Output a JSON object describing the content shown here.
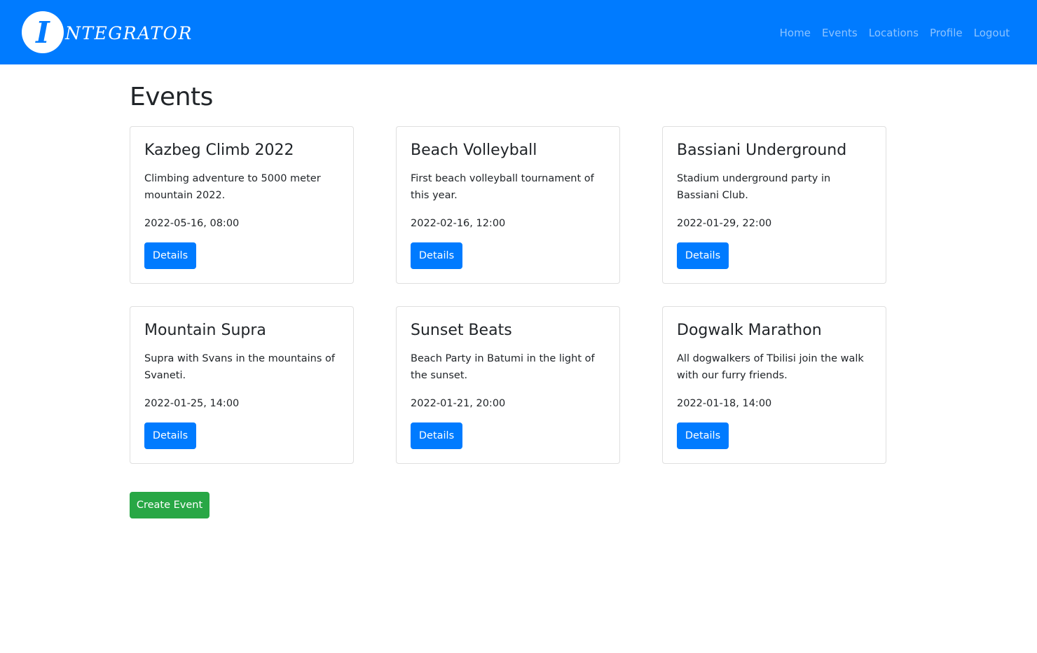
{
  "navbar": {
    "logo_letter": "I",
    "brand_text": "NTEGRATOR",
    "links": [
      "Home",
      "Events",
      "Locations",
      "Profile",
      "Logout"
    ]
  },
  "page": {
    "title": "Events"
  },
  "events": [
    {
      "title": "Kazbeg Climb 2022",
      "description": "Climbing adventure to 5000 meter mountain 2022.",
      "datetime": "2022-05-16, 08:00",
      "button_label": "Details"
    },
    {
      "title": "Beach Volleyball",
      "description": "First beach volleyball tournament of this year.",
      "datetime": "2022-02-16, 12:00",
      "button_label": "Details"
    },
    {
      "title": "Bassiani Underground",
      "description": "Stadium underground party in Bassiani Club.",
      "datetime": "2022-01-29, 22:00",
      "button_label": "Details"
    },
    {
      "title": "Mountain Supra",
      "description": "Supra with Svans in the mountains of Svaneti.",
      "datetime": "2022-01-25, 14:00",
      "button_label": "Details"
    },
    {
      "title": "Sunset Beats",
      "description": "Beach Party in Batumi in the light of the sunset.",
      "datetime": "2022-01-21, 20:00",
      "button_label": "Details"
    },
    {
      "title": "Dogwalk Marathon",
      "description": "All dogwalkers of Tbilisi join the walk with our furry friends.",
      "datetime": "2022-01-18, 14:00",
      "button_label": "Details"
    }
  ],
  "actions": {
    "create_label": "Create Event"
  },
  "colors": {
    "primary": "#007bff",
    "success": "#28a745",
    "nav_link": "rgba(255,255,255,0.55)"
  }
}
